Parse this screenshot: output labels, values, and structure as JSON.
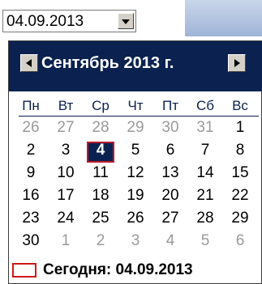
{
  "date_picker": {
    "value": "04.09.2013"
  },
  "calendar": {
    "month_title": "Сентябрь 2013 г.",
    "weekdays": [
      "Пн",
      "Вт",
      "Ср",
      "Чт",
      "Пт",
      "Сб",
      "Вс"
    ],
    "weeks": [
      [
        "26",
        "27",
        "28",
        "29",
        "30",
        "31",
        "1"
      ],
      [
        "2",
        "3",
        "4",
        "5",
        "6",
        "7",
        "8"
      ],
      [
        "9",
        "10",
        "11",
        "12",
        "13",
        "14",
        "15"
      ],
      [
        "16",
        "17",
        "18",
        "19",
        "20",
        "21",
        "22"
      ],
      [
        "23",
        "24",
        "25",
        "26",
        "27",
        "28",
        "29"
      ],
      [
        "30",
        "1",
        "2",
        "3",
        "4",
        "5",
        "6"
      ]
    ],
    "selected_day": "4",
    "today_label": "Сегодня: 04.09.2013"
  },
  "colors": {
    "header_bg": "#0b2150",
    "today_border": "#d01818",
    "other_month_text": "#9a9a9a"
  }
}
